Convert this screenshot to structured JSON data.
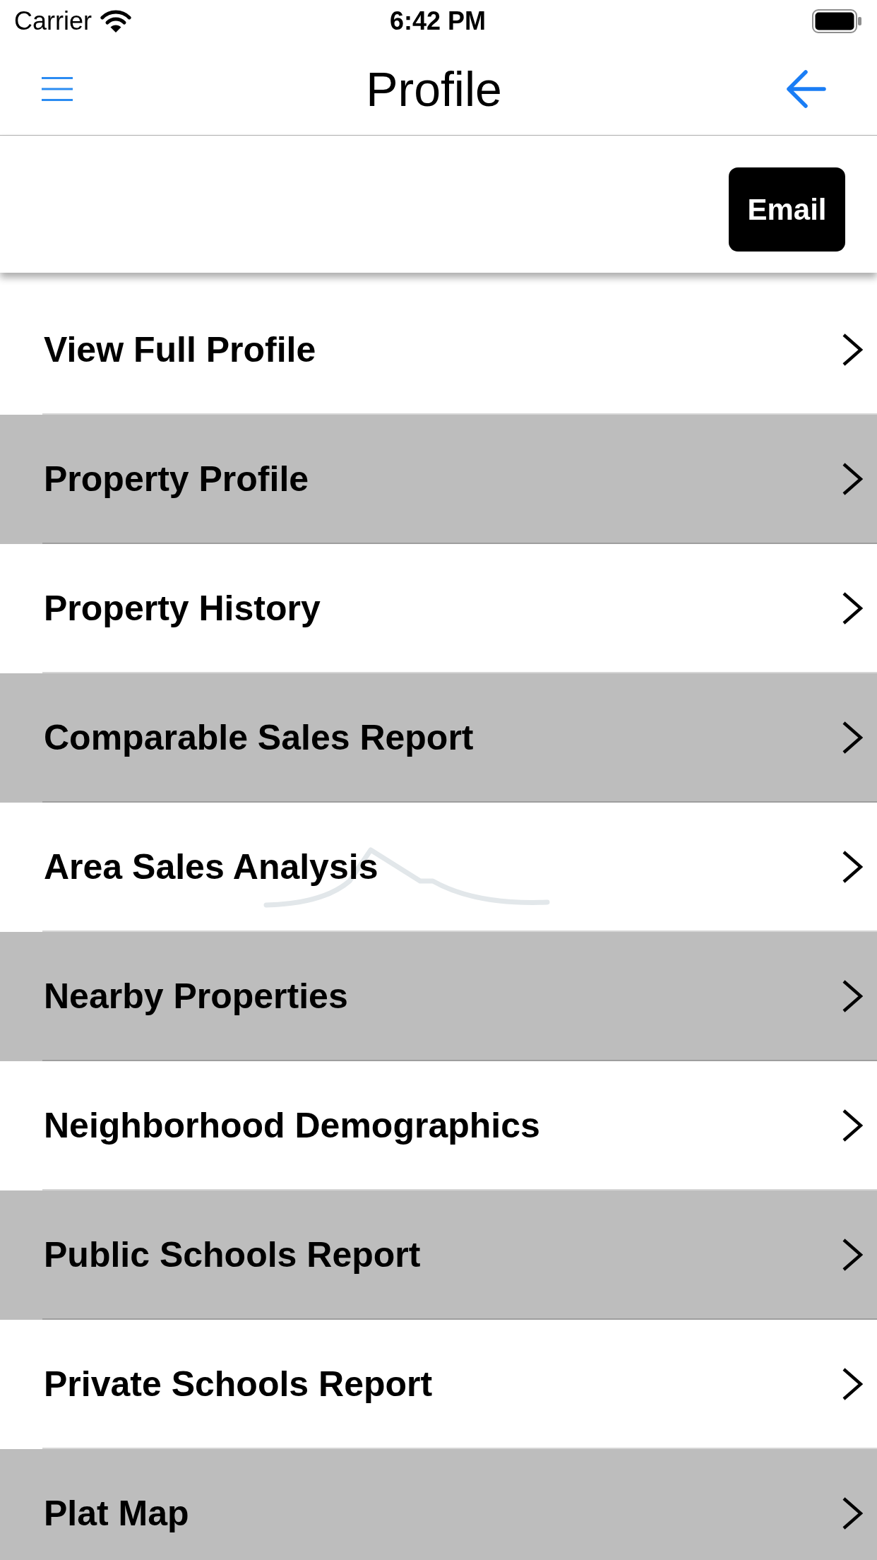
{
  "status_bar": {
    "carrier": "Carrier",
    "time": "6:42 PM"
  },
  "nav_bar": {
    "title": "Profile"
  },
  "action_panel": {
    "button": "Email"
  },
  "menu": {
    "items": [
      {
        "label": "View Full Profile"
      },
      {
        "label": "Property Profile"
      },
      {
        "label": "Property History"
      },
      {
        "label": "Comparable Sales Report"
      },
      {
        "label": "Area Sales Analysis"
      },
      {
        "label": "Nearby Properties"
      },
      {
        "label": "Neighborhood Demographics"
      },
      {
        "label": "Public Schools Report"
      },
      {
        "label": "Private Schools Report"
      },
      {
        "label": "Plat Map"
      }
    ]
  }
}
